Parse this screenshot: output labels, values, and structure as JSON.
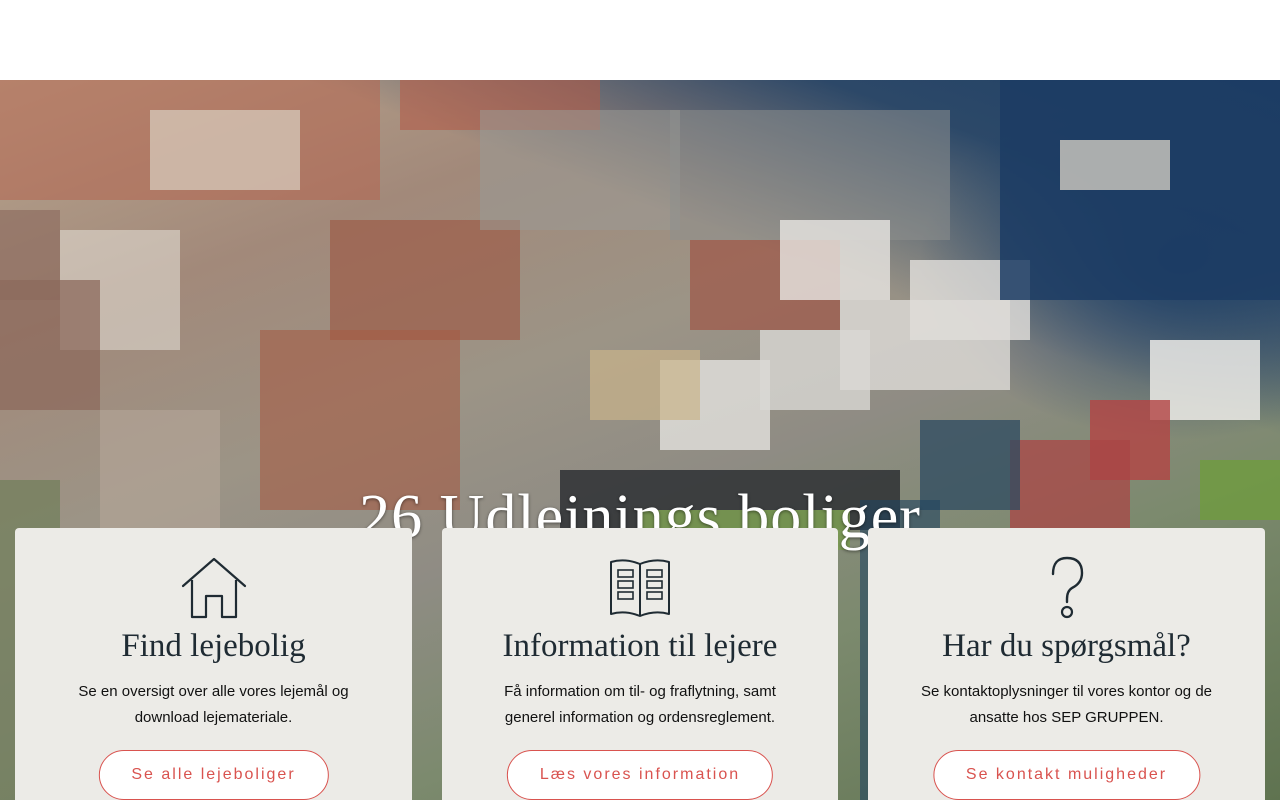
{
  "hero": {
    "title": "26 Udlejnings boliger"
  },
  "cards": [
    {
      "icon": "house-icon",
      "title": "Find lejebolig",
      "text": "Se en oversigt over alle vores lejemål og download lejemateriale.",
      "button": "Se alle lejeboliger"
    },
    {
      "icon": "book-icon",
      "title": "Information til lejere",
      "text": "Få information om til- og fraflytning, samt generel information og ordensreglement.",
      "button": "Læs vores information"
    },
    {
      "icon": "question-mark-icon",
      "title": "Har du spørgsmål?",
      "text": "Se kontaktoplysninger til vores kontor og de ansatte hos SEP GRUPPEN.",
      "button": "Se kontakt muligheder"
    }
  ],
  "colors": {
    "accent": "#d9534f",
    "card_bg": "#ecebe7",
    "title": "#1f2b33"
  }
}
